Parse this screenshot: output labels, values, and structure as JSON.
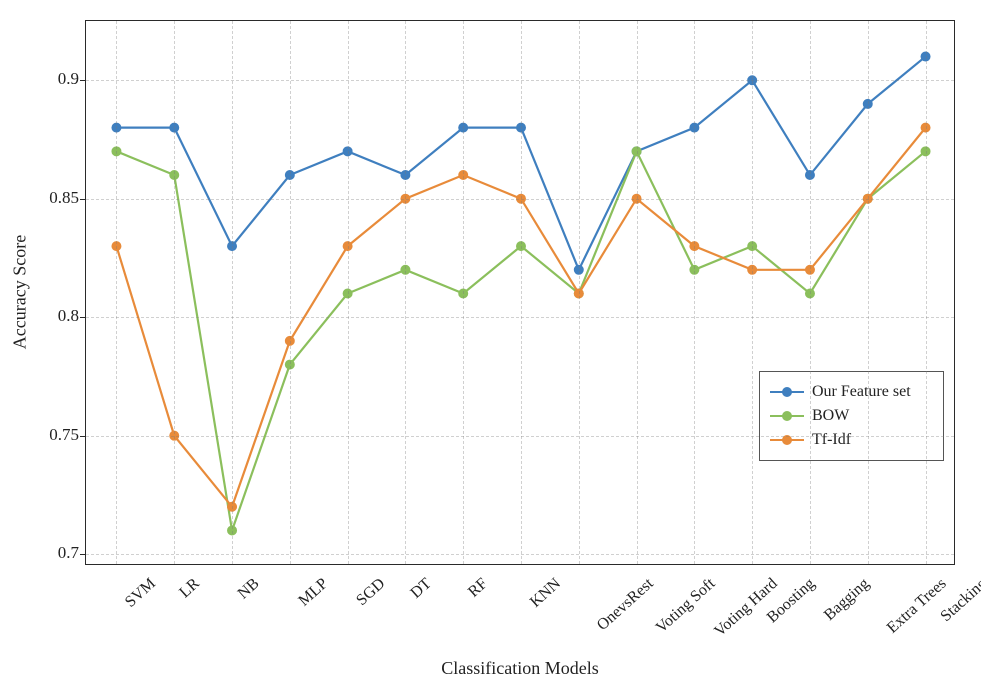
{
  "chart_data": {
    "type": "line",
    "xlabel": "Classification Models",
    "ylabel": "Accuracy Score",
    "ylim": [
      0.695,
      0.925
    ],
    "yticks": [
      0.7,
      0.75,
      0.8,
      0.85,
      0.9
    ],
    "ytick_labels": [
      "0.7",
      "0.75",
      "0.8",
      "0.85",
      "0.9"
    ],
    "categories": [
      "SVM",
      "LR",
      "NB",
      "MLP",
      "SGD",
      "DT",
      "RF",
      "KNN",
      "OnevsRest",
      "Voting Soft",
      "Voting Hard",
      "Boosting",
      "Bagging",
      "Extra Trees",
      "Stacking"
    ],
    "series": [
      {
        "name": "Our Feature set",
        "color": "#3f7fbf",
        "values": [
          0.88,
          0.88,
          0.83,
          0.86,
          0.87,
          0.86,
          0.88,
          0.88,
          0.82,
          0.87,
          0.88,
          0.9,
          0.86,
          0.89,
          0.91
        ]
      },
      {
        "name": "BOW",
        "color": "#8bbf5c",
        "values": [
          0.87,
          0.86,
          0.71,
          0.78,
          0.81,
          0.82,
          0.81,
          0.83,
          0.81,
          0.87,
          0.82,
          0.83,
          0.81,
          0.85,
          0.87
        ]
      },
      {
        "name": "Tf-Idf",
        "color": "#e88b3a",
        "values": [
          0.83,
          0.75,
          0.72,
          0.79,
          0.83,
          0.85,
          0.86,
          0.85,
          0.81,
          0.85,
          0.83,
          0.82,
          0.82,
          0.85,
          0.88
        ]
      }
    ],
    "legend_position": "right-inside"
  }
}
